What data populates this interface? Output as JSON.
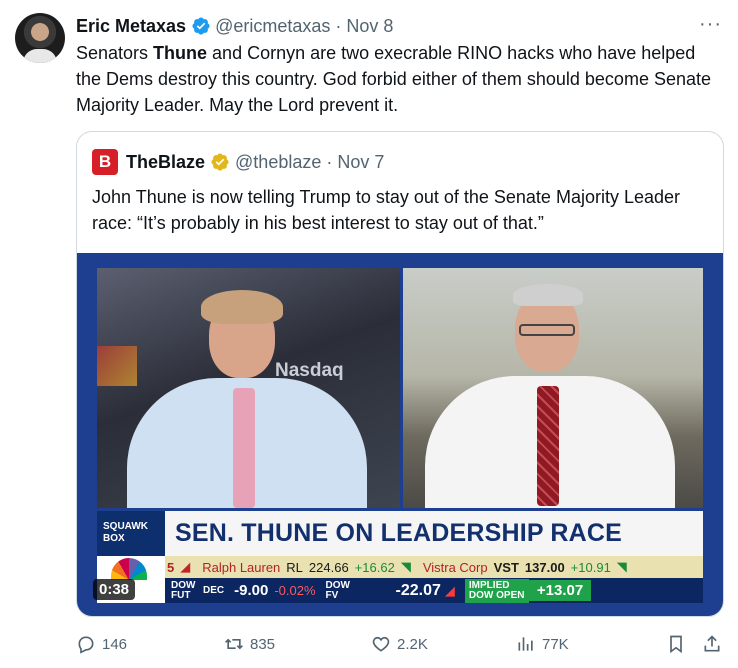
{
  "tweet": {
    "author_name": "Eric Metaxas",
    "handle": "@ericmetaxas",
    "separator": "·",
    "date": "Nov 8",
    "more": "···",
    "text_before": "Senators ",
    "text_bold": "Thune",
    "text_after": " and Cornyn are two execrable RINO hacks who have helped the Dems destroy this country. God forbid either of them should become Senate Majority Leader. May the Lord prevent it."
  },
  "quote": {
    "logo_letter": "B",
    "author_name": "TheBlaze",
    "handle": "@theblaze",
    "separator": "·",
    "date": "Nov 7",
    "text": "John Thune is now telling Trump to stay out of the Senate Majority Leader race: “It’s probably in his best interest to stay out of that.”"
  },
  "video": {
    "timestamp": "0:38",
    "nasdaq": "Nasdaq",
    "squawk_box": "SQUAWK BOX",
    "headline": "SEN. THUNE ON LEADERSHIP RACE",
    "ticker_top": {
      "lead_value": "5",
      "item1_name": "Ralph Lauren",
      "item1_symbol": "RL",
      "item1_price": "224.66",
      "item1_change": "+16.62",
      "item2_name": "Vistra Corp",
      "item2_symbol": "VST",
      "item2_price": "137.00",
      "item2_change": "+10.91"
    },
    "ticker_bottom": {
      "dow_fut_label": "DOW FUT",
      "dow_fut_month": "DEC",
      "dow_fut_value": "-9.00",
      "dow_fut_pct": "-0.02%",
      "dow_fv_label": "DOW FV",
      "dow_fv_value": "-22.07",
      "implied_label": "IMPLIED DOW OPEN",
      "implied_value": "+13.07"
    }
  },
  "actions": {
    "replies": "146",
    "reposts": "835",
    "likes": "2.2K",
    "views": "77K"
  },
  "colors": {
    "verified_blue": "#1d9bf0",
    "verified_gold": "#e2b719",
    "blaze_red": "#d61f26",
    "secondary_text": "#536471"
  }
}
